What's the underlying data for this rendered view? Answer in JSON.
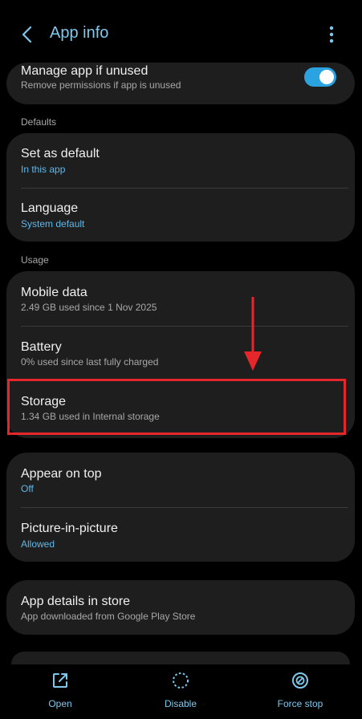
{
  "header": {
    "title": "App info"
  },
  "manage_unused": {
    "title": "Manage app if unused",
    "subtitle": "Remove permissions if app is unused",
    "enabled": true
  },
  "defaults": {
    "label": "Defaults",
    "set_default": {
      "title": "Set as default",
      "subtitle": "In this app"
    },
    "language": {
      "title": "Language",
      "subtitle": "System default"
    }
  },
  "usage": {
    "label": "Usage",
    "mobile_data": {
      "title": "Mobile data",
      "subtitle": "2.49 GB used since 1 Nov 2025"
    },
    "battery": {
      "title": "Battery",
      "subtitle": "0% used since last fully charged"
    },
    "storage": {
      "title": "Storage",
      "subtitle": "1.34 GB used in Internal storage"
    }
  },
  "display": {
    "appear_on_top": {
      "title": "Appear on top",
      "subtitle": "Off"
    },
    "pip": {
      "title": "Picture-in-picture",
      "subtitle": "Allowed"
    }
  },
  "store": {
    "title": "App details in store",
    "subtitle": "App downloaded from Google Play Store"
  },
  "actions": {
    "open": "Open",
    "disable": "Disable",
    "force_stop": "Force stop"
  },
  "colors": {
    "accent": "#7fc8ee",
    "link_blue": "#5fb8ea",
    "toggle_on": "#2aa3e0",
    "highlight_red": "#e5262b",
    "card_bg": "#1e1e1e"
  }
}
